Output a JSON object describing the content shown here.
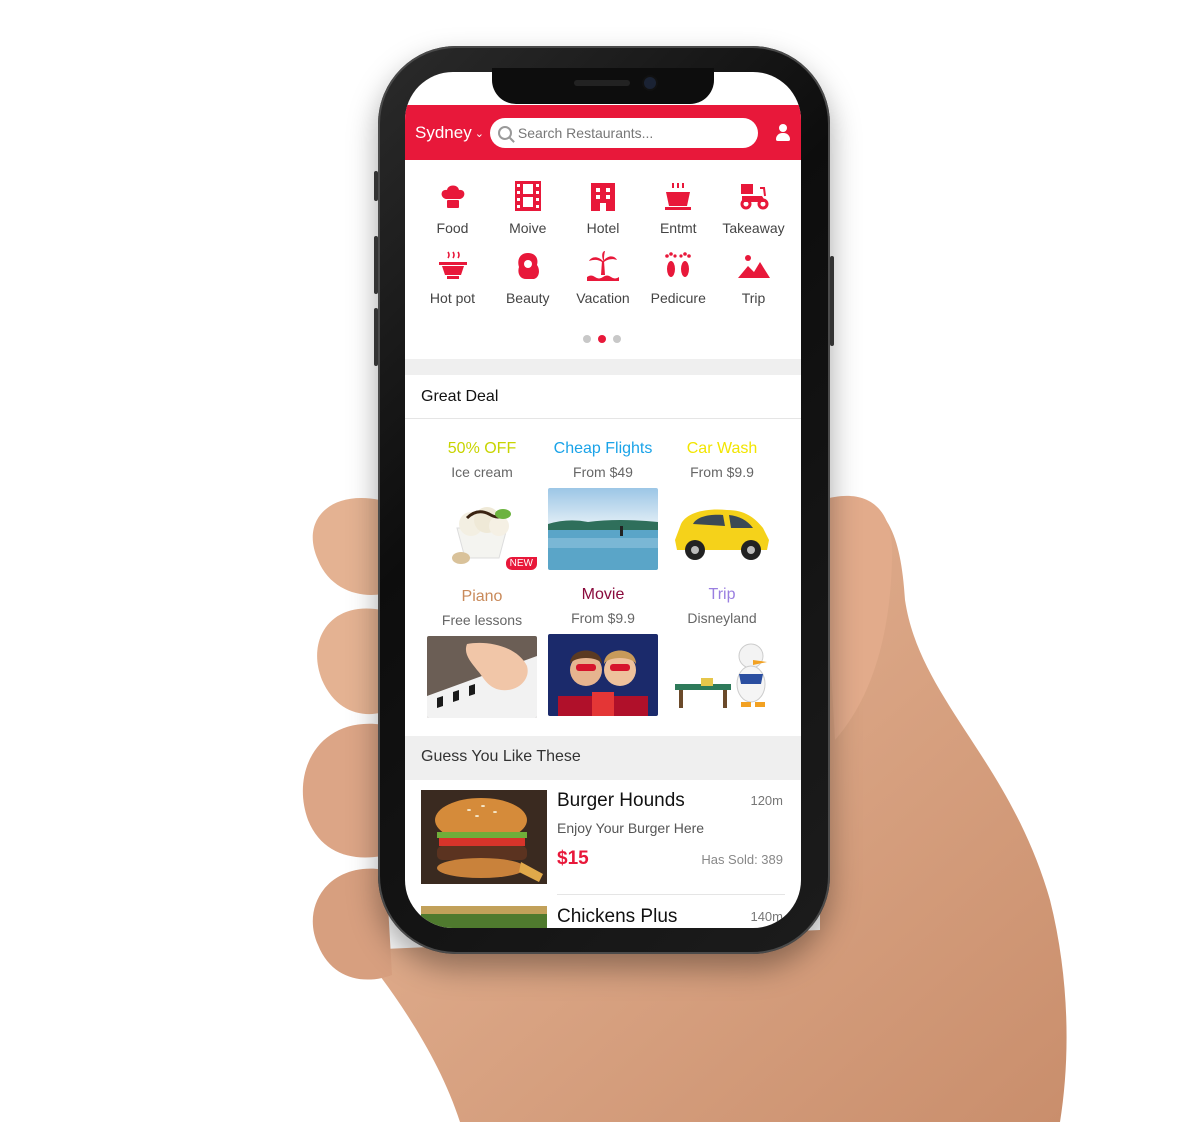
{
  "header": {
    "city": "Sydney",
    "search_placeholder": "Search Restaurants..."
  },
  "categories": [
    {
      "label": "Food",
      "icon": "chef-hat-icon"
    },
    {
      "label": "Moive",
      "icon": "film-icon"
    },
    {
      "label": "Hotel",
      "icon": "hotel-icon"
    },
    {
      "label": "Entmt",
      "icon": "cup-icon"
    },
    {
      "label": "Takeaway",
      "icon": "scooter-icon"
    },
    {
      "label": "Hot pot",
      "icon": "hot-pot-icon"
    },
    {
      "label": "Beauty",
      "icon": "beauty-icon"
    },
    {
      "label": "Vacation",
      "icon": "palm-tree-icon"
    },
    {
      "label": "Pedicure",
      "icon": "footprints-icon"
    },
    {
      "label": "Trip",
      "icon": "mountain-icon"
    }
  ],
  "pager": {
    "pages": 3,
    "active": 2
  },
  "great_deal": {
    "title": "Great Deal",
    "deals": [
      {
        "title": "50% OFF",
        "subtitle": "Ice cream",
        "color": "#c8d400",
        "badge": "NEW"
      },
      {
        "title": "Cheap Flights",
        "subtitle": "From $49",
        "color": "#1aa3e8"
      },
      {
        "title": "Car Wash",
        "subtitle": "From $9.9",
        "color": "#f2e500"
      },
      {
        "title": "Piano",
        "subtitle": "Free lessons",
        "color": "#c98a5a"
      },
      {
        "title": "Movie",
        "subtitle": "From $9.9",
        "color": "#8a0a3c"
      },
      {
        "title": "Trip",
        "subtitle": "Disneyland",
        "color": "#9a7fe0"
      }
    ]
  },
  "guess": {
    "title": "Guess You Like These",
    "items": [
      {
        "name": "Burger Hounds",
        "distance": "120m",
        "desc": "Enjoy Your Burger Here",
        "price": "$15",
        "sold": "Has Sold: 389"
      },
      {
        "name": "Chickens Plus",
        "distance": "140m"
      }
    ]
  },
  "colors": {
    "accent": "#e8183a"
  }
}
